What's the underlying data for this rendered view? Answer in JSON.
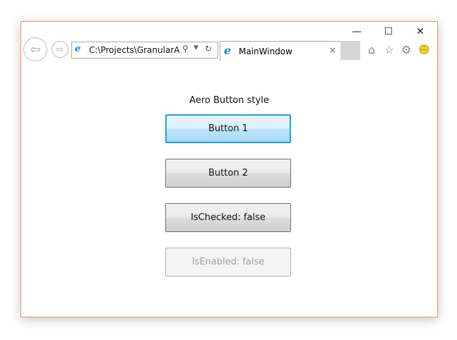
{
  "window": {
    "minimize_icon": "minimize-icon",
    "maximize_icon": "maximize-icon",
    "close_icon": "close-icon"
  },
  "browser": {
    "address": "C:\\Projects\\GranularApp",
    "tab_title": "MainWindow",
    "tab_close": "×"
  },
  "content": {
    "label": "Aero Button style",
    "buttons": [
      "Button 1",
      "Button 2",
      "IsChecked: false",
      "IsEnabled: false"
    ]
  },
  "colors": {
    "window_border": "#f0907a",
    "focus_border": "#26a0da"
  }
}
